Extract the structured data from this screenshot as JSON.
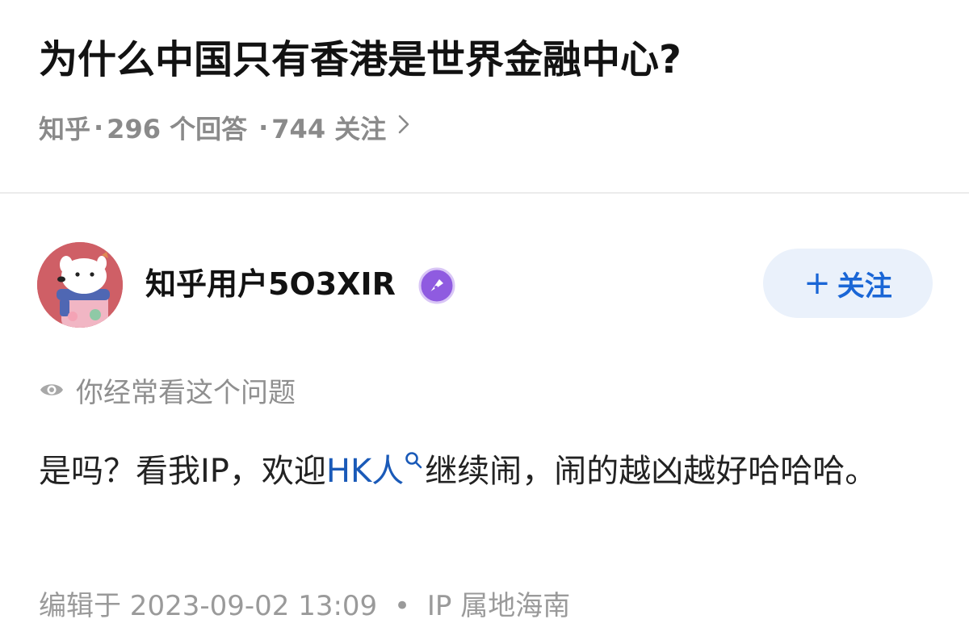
{
  "question": {
    "title": "为什么中国只有香港是世界金融中心?",
    "source": "知乎",
    "answer_count": "296 个回答",
    "follower_count": "744 关注",
    "separator": "·"
  },
  "author": {
    "name": "知乎用户5O3XIR",
    "follow_label": "关注",
    "follow_plus": "+"
  },
  "hint": {
    "text": "你经常看这个问题"
  },
  "answer": {
    "text_before": "是吗？看我IP，欢迎",
    "tag_link": "HK人",
    "text_after": "继续闹，闹的越凶越好哈哈哈。"
  },
  "footer": {
    "edited": "编辑于 2023-09-02 13:09",
    "dot": "•",
    "ip_location": "IP 属地海南"
  },
  "colors": {
    "accent_blue": "#1a66d6",
    "follow_bg": "#eaf1fb",
    "badge_purple": "#8f5be0",
    "muted_text": "#8a8a8a",
    "avatar_bg": "#cf5f66"
  }
}
